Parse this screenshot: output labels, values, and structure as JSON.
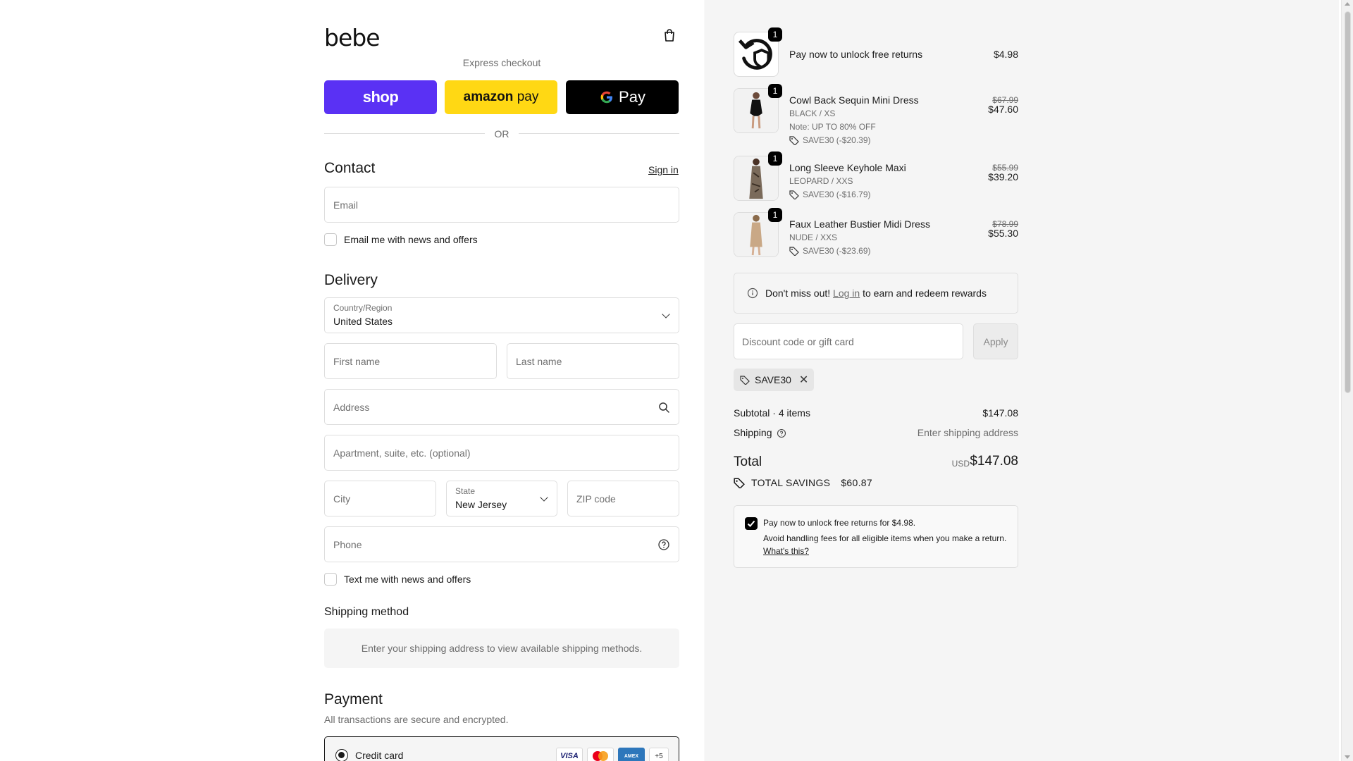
{
  "brand": {
    "logo_text": "bebe"
  },
  "express": {
    "title": "Express checkout",
    "shop_label": "shop",
    "amazon_label_a": "amazon",
    "amazon_label_b": "pay",
    "gpay_label": "Pay",
    "or_label": "OR"
  },
  "contact": {
    "heading": "Contact",
    "sign_in": "Sign in",
    "email_placeholder": "Email",
    "news_label": "Email me with news and offers"
  },
  "delivery": {
    "heading": "Delivery",
    "country_label": "Country/Region",
    "country_value": "United States",
    "first_name": "First name",
    "last_name": "Last name",
    "address": "Address",
    "apartment": "Apartment, suite, etc. (optional)",
    "city": "City",
    "state_label": "State",
    "state_value": "New Jersey",
    "zip": "ZIP code",
    "phone": "Phone",
    "text_label": "Text me with news and offers"
  },
  "shipping_method": {
    "heading": "Shipping method",
    "message": "Enter your shipping address to view available shipping methods."
  },
  "payment": {
    "heading": "Payment",
    "subtitle": "All transactions are secure and encrypted.",
    "credit_card_label": "Credit card",
    "cards": [
      "VISA",
      "mastercard",
      "AMEX"
    ],
    "more_cards": "+5"
  },
  "order": {
    "items": [
      {
        "name": "Pay now to unlock free returns",
        "qty": "1",
        "price": "$4.98",
        "icon": "returns-icon"
      },
      {
        "name": "Cowl Back Sequin Mini Dress",
        "qty": "1",
        "variant": "BLACK / XS",
        "note": "Note: UP TO 80% OFF",
        "discount": "SAVE30 (-$20.39)",
        "orig": "$67.99",
        "price": "$47.60"
      },
      {
        "name": "Long Sleeve Keyhole Maxi",
        "qty": "1",
        "variant": "LEOPARD / XXS",
        "discount": "SAVE30 (-$16.79)",
        "orig": "$55.99",
        "price": "$39.20"
      },
      {
        "name": "Faux Leather Bustier Midi Dress",
        "qty": "1",
        "variant": "NUDE / XXS",
        "discount": "SAVE30 (-$23.69)",
        "orig": "$78.99",
        "price": "$55.30"
      }
    ],
    "rewards": {
      "pre": "Don't miss out!",
      "link": "Log in",
      "post": "to earn and redeem rewards"
    },
    "discount_placeholder": "Discount code or gift card",
    "apply_label": "Apply",
    "applied_code": "SAVE30",
    "subtotal_label": "Subtotal · 4 items",
    "subtotal_value": "$147.08",
    "shipping_label": "Shipping",
    "shipping_value": "Enter shipping address",
    "total_label": "Total",
    "currency": "USD",
    "total_value": "$147.08",
    "savings_label": "TOTAL SAVINGS",
    "savings_value": "$60.87",
    "upsell": {
      "line1": "Pay now to unlock free returns for $4.98.",
      "line2": "Avoid handling fees for all eligible items when you make a return.",
      "link": "What's this?"
    }
  },
  "colors": {
    "shop": "#5a31f4",
    "amazon": "#ffd814",
    "gpay": "#000000",
    "aside_bg": "#f5f5f5"
  }
}
